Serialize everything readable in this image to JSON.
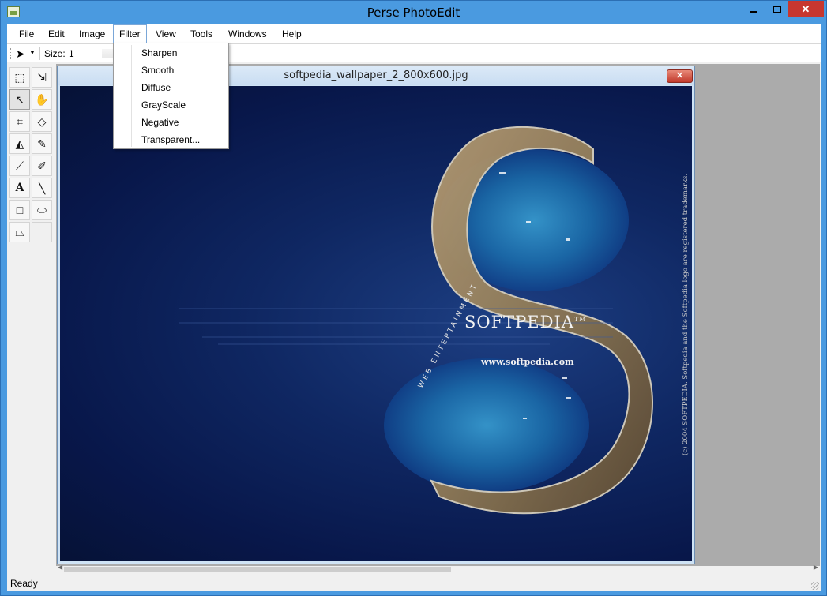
{
  "window": {
    "title": "Perse PhotoEdit"
  },
  "menubar": {
    "items": [
      "File",
      "Edit",
      "Image",
      "Filter",
      "View",
      "Tools",
      "Windows",
      "Help"
    ]
  },
  "toolbar": {
    "size_label": "Size:",
    "size_value": "1"
  },
  "tools": [
    {
      "name": "rect-select-icon",
      "glyph": "⬚"
    },
    {
      "name": "move-select-icon",
      "glyph": "⇲"
    },
    {
      "name": "pointer-icon",
      "glyph": "↖"
    },
    {
      "name": "hand-icon",
      "glyph": "✋"
    },
    {
      "name": "crop-icon",
      "glyph": "⌗"
    },
    {
      "name": "eraser-icon",
      "glyph": "◇"
    },
    {
      "name": "fill-bucket-icon",
      "glyph": "◭"
    },
    {
      "name": "pencil-icon",
      "glyph": "✎"
    },
    {
      "name": "eyedropper-icon",
      "glyph": "⟋"
    },
    {
      "name": "brush-icon",
      "glyph": "✐"
    },
    {
      "name": "text-tool-icon",
      "glyph": "A"
    },
    {
      "name": "line-tool-icon",
      "glyph": "╲"
    },
    {
      "name": "rectangle-tool-icon",
      "glyph": "□"
    },
    {
      "name": "ellipse-tool-icon",
      "glyph": "⬭"
    },
    {
      "name": "polygon-tool-icon",
      "glyph": "⏢"
    }
  ],
  "document": {
    "title": "softpedia_wallpaper_2_800x600.jpg",
    "image_text": {
      "brand": "SOFTPEDIA",
      "tm": "TM",
      "url": "www.softpedia.com",
      "arc_text": "WEB ENTERTAINMENT",
      "copyright": "(c) 2004 SOFTPEDIA. Softpedia and the Softpedia logo are registered trademarks."
    }
  },
  "filter_menu": {
    "items": [
      "Sharpen",
      "Smooth",
      "Diffuse",
      "GrayScale",
      "Negative",
      "Transparent..."
    ]
  },
  "statusbar": {
    "text": "Ready"
  },
  "colors": {
    "titlebar": "#4a9ae0",
    "close_red": "#c7372f",
    "workspace": "#ababab"
  }
}
